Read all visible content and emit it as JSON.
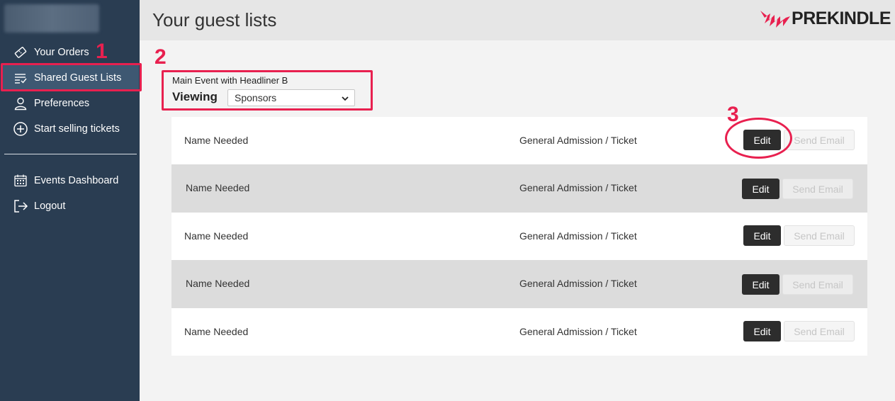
{
  "sidebar": {
    "items": [
      {
        "label": "Your Orders",
        "icon": "ticket-icon"
      },
      {
        "label": "Shared Guest Lists",
        "icon": "list-check-icon"
      },
      {
        "label": "Preferences",
        "icon": "user-icon"
      },
      {
        "label": "Start selling tickets",
        "icon": "plus-circle-icon"
      },
      {
        "label": "Events Dashboard",
        "icon": "calendar-icon"
      },
      {
        "label": "Logout",
        "icon": "logout-icon"
      }
    ],
    "active_index": 1
  },
  "header": {
    "title": "Your guest lists",
    "logo_text": "PREKINDLE"
  },
  "event": {
    "name": "Main Event with Headliner B",
    "viewing_label": "Viewing",
    "viewing_value": "Sponsors"
  },
  "rows": [
    {
      "name": "Name Needed",
      "ticket": "General Admission / Ticket",
      "edit": "Edit",
      "email": "Send Email"
    },
    {
      "name": "Name Needed",
      "ticket": "General Admission / Ticket",
      "edit": "Edit",
      "email": "Send Email"
    },
    {
      "name": "Name Needed",
      "ticket": "General Admission / Ticket",
      "edit": "Edit",
      "email": "Send Email"
    },
    {
      "name": "Name Needed",
      "ticket": "General Admission / Ticket",
      "edit": "Edit",
      "email": "Send Email"
    },
    {
      "name": "Name Needed",
      "ticket": "General Admission / Ticket",
      "edit": "Edit",
      "email": "Send Email"
    }
  ],
  "annotations": {
    "one": "1",
    "two": "2",
    "three": "3",
    "color": "#e8204f"
  },
  "colors": {
    "sidebar": "#2a3d52",
    "sidebar_active": "#3e5872",
    "brand": "#e8204f"
  }
}
